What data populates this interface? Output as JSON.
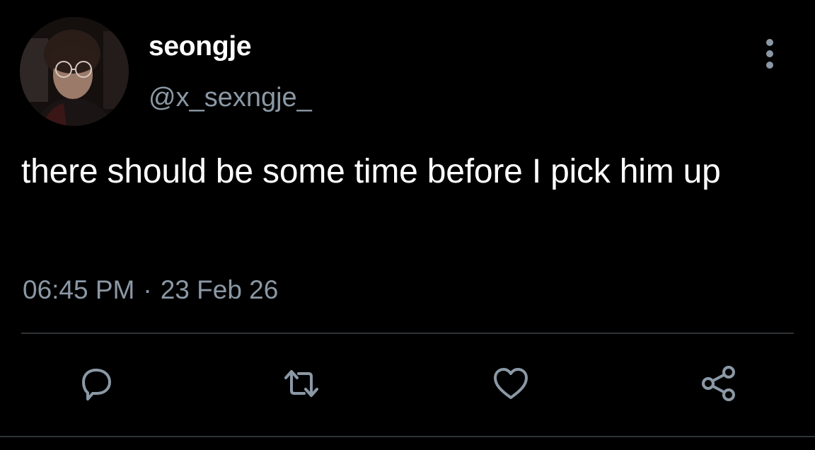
{
  "tweet": {
    "display_name": "seongje",
    "handle": "@x_sexngje_",
    "text": "there should be some time before I pick him up",
    "time": "06:45 PM",
    "separator": "·",
    "date": "23 Feb 26"
  },
  "icons": {
    "avatar": "profile-photo",
    "more": "more-vertical-icon",
    "reply": "reply-icon",
    "retweet": "retweet-icon",
    "like": "heart-icon",
    "share": "share-icon"
  },
  "colors": {
    "background": "#000000",
    "primary_text": "#ffffff",
    "secondary_text": "#8b98a5",
    "divider": "#2f3336",
    "icon": "#8b98a5"
  }
}
